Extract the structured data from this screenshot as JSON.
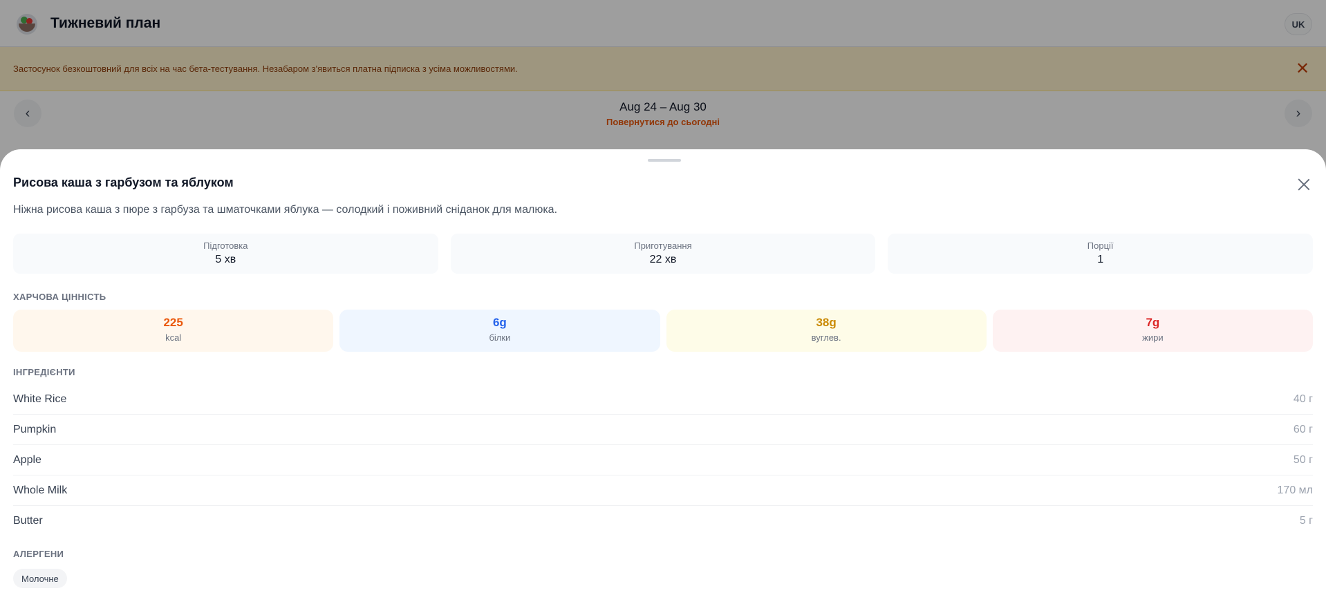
{
  "header": {
    "title": "Тижневий план",
    "lang": "UK"
  },
  "banner": {
    "text": "Застосунок безкоштовний для всіх на час бета-тестування. Незабаром з'явиться платна підписка з усіма можливостями."
  },
  "week": {
    "range": "Aug 24 – Aug 30",
    "today_link": "Повернутися до сьогодні"
  },
  "recipe": {
    "title": "Рисова каша з гарбузом та яблуком",
    "description": "Ніжна рисова каша з пюре з гарбуза та шматочками яблука — солодкий і поживний сніданок для малюка.",
    "stats": [
      {
        "label": "Підготовка",
        "value": "5 хв"
      },
      {
        "label": "Приготування",
        "value": "22 хв"
      },
      {
        "label": "Порції",
        "value": "1"
      }
    ],
    "nutrition_heading": "ХАРЧОВА ЦІННІСТЬ",
    "nutrition": [
      {
        "value": "225",
        "label": "kcal",
        "color": "#ea580c",
        "bg": "#fff7ed"
      },
      {
        "value": "6g",
        "label": "білки",
        "color": "#2563eb",
        "bg": "#eff6ff"
      },
      {
        "value": "38g",
        "label": "вуглев.",
        "color": "#ca8a04",
        "bg": "#fefce8"
      },
      {
        "value": "7g",
        "label": "жири",
        "color": "#dc2626",
        "bg": "#fef2f2"
      }
    ],
    "ingredients_heading": "ІНГРЕДІЄНТИ",
    "ingredients": [
      {
        "name": "White Rice",
        "amount": "40 г"
      },
      {
        "name": "Pumpkin",
        "amount": "60 г"
      },
      {
        "name": "Apple",
        "amount": "50 г"
      },
      {
        "name": "Whole Milk",
        "amount": "170 мл"
      },
      {
        "name": "Butter",
        "amount": "5 г"
      }
    ],
    "allergens_heading": "АЛЕРГЕНИ",
    "allergens": [
      "Молочне"
    ]
  },
  "icons": {
    "logo": "salad-bowl-icon",
    "banner_close": "close-icon",
    "prev": "chevron-left-icon",
    "next": "chevron-right-icon",
    "sheet_close": "close-icon"
  }
}
